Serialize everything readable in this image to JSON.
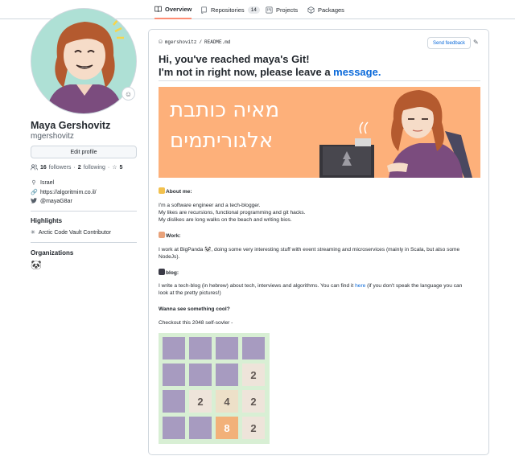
{
  "nav": {
    "tabs": [
      {
        "label": "Overview",
        "icon": "book-icon"
      },
      {
        "label": "Repositories",
        "count": "14",
        "icon": "repo-icon"
      },
      {
        "label": "Projects",
        "icon": "project-icon"
      },
      {
        "label": "Packages",
        "icon": "package-icon"
      }
    ]
  },
  "profile": {
    "name": "Maya Gershovitz",
    "username": "mgershovitz",
    "edit_label": "Edit profile",
    "followers_count": "16",
    "followers_label": "followers",
    "following_count": "2",
    "following_label": "following",
    "stars_count": "5",
    "location": "Israel",
    "website": "https://algoritmim.co.il/",
    "twitter": "@mayaG8ar",
    "highlights_title": "Highlights",
    "highlight_item": "Arctic Code Vault Contributor",
    "organizations_title": "Organizations"
  },
  "readme": {
    "path_user": "mgershovitz",
    "path_sep": "/",
    "path_file": "README.md",
    "feedback_label": "Send feedback",
    "heading_line1": "Hi, you've reached maya's Git!",
    "heading_line2_prefix": "I'm not in right now, please leave a ",
    "heading_line2_link": "message",
    "heading_line2_suffix": ".",
    "banner_line1": "מאיה כותבת",
    "banner_line2": "אלגוריתמים",
    "about_title": "About me:",
    "about_lines": [
      "I'm a software engineer and a tech-blogger.",
      "My likes are recursions, functional programming and git hacks.",
      "My dislikes are long walks on the beach and writing bios."
    ],
    "work_title": "Work:",
    "work_lines": [
      "I work at BigPanda 🐼, doing some very interesting stuff with event streaming and microservices (mainly in Scala, but also some",
      "NodeJs)."
    ],
    "blog_title": "blog:",
    "blog_prefix": "I write a tech-blog (in hebrew) about tech, interviews and algorithms. You can find it ",
    "blog_link": "here",
    "blog_suffix": " (if you don't speak the language you can",
    "blog_line2": "look at the pretty pictures!)",
    "cool_title": "Wanna see something cool?",
    "cool_text": "Checkout this 2048 self-sovler -"
  },
  "game_board": [
    [
      "",
      "",
      "",
      ""
    ],
    [
      "",
      "",
      "",
      "2"
    ],
    [
      "",
      "2",
      "4",
      "2"
    ],
    [
      "",
      "",
      "8",
      "2"
    ]
  ],
  "colors": {
    "tab_underline": "#fd8c73",
    "link": "#0969da",
    "banner_bg": "#fdb07a",
    "board_bg": "#d8efd4",
    "tile_empty": "#a79bc0",
    "tile_2": "#eee4da",
    "tile_4": "#ede0c8",
    "tile_8": "#f2b179"
  }
}
